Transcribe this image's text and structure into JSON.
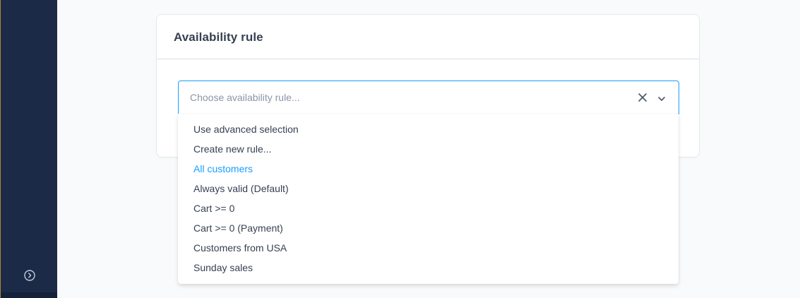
{
  "sidebar": {
    "toggle_icon": "chevron-right-circle-icon"
  },
  "card": {
    "title": "Availability rule"
  },
  "select": {
    "value": "",
    "placeholder": "Choose availability rule...",
    "clear_icon": "close-icon",
    "expand_icon": "chevron-down-icon",
    "accent_color": "#189eff"
  },
  "dropdown": {
    "items": [
      {
        "label": "Use advanced selection"
      },
      {
        "label": "Create new rule..."
      },
      {
        "label": "All customers",
        "active": true
      },
      {
        "label": "Always valid (Default)"
      },
      {
        "label": "Cart >= 0"
      },
      {
        "label": "Cart >= 0 (Payment)"
      },
      {
        "label": "Customers from USA"
      },
      {
        "label": "Sunday sales"
      }
    ]
  },
  "colors": {
    "sidebar_bg": "#1b2a47",
    "text": "#364152",
    "accent": "#189eff"
  }
}
